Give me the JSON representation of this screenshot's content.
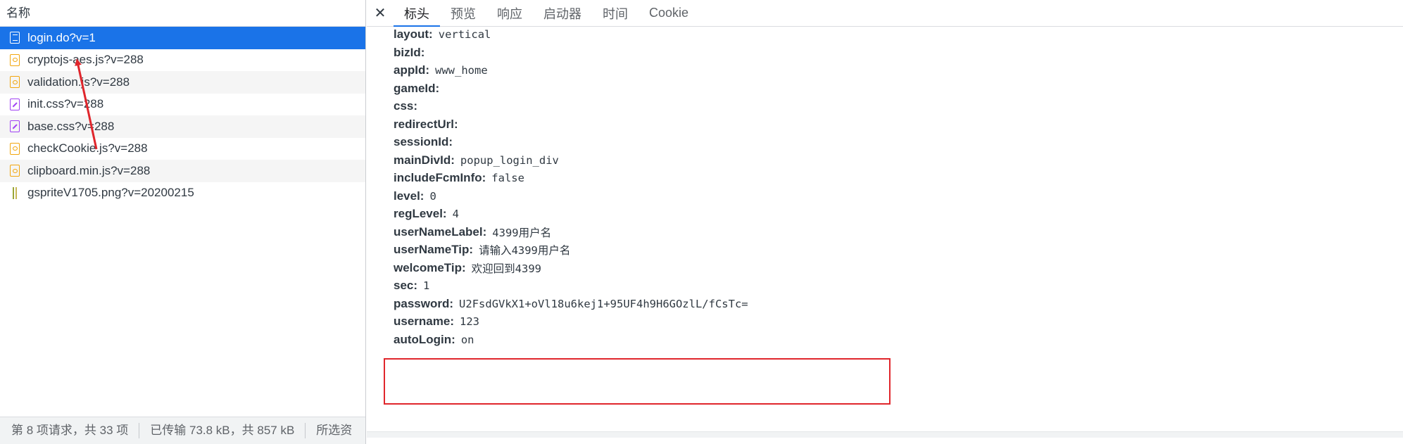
{
  "left_panel": {
    "header": "名称",
    "requests": [
      {
        "name": "login.do?v=1",
        "icon": "document-icon"
      },
      {
        "name": "cryptojs-aes.js?v=288",
        "icon": "script-icon"
      },
      {
        "name": "validation.js?v=288",
        "icon": "script-icon"
      },
      {
        "name": "init.css?v=288",
        "icon": "stylesheet-icon"
      },
      {
        "name": "base.css?v=288",
        "icon": "stylesheet-icon"
      },
      {
        "name": "checkCookie.js?v=288",
        "icon": "script-icon"
      },
      {
        "name": "clipboard.min.js?v=288",
        "icon": "script-icon"
      },
      {
        "name": "gspriteV1705.png?v=20200215",
        "icon": "image-icon"
      }
    ],
    "status": {
      "requests": "第 8 项请求，共 33 项",
      "transferred": "已传输 73.8 kB，共 857 kB",
      "selected": "所选资"
    }
  },
  "right_panel": {
    "close_label": "✕",
    "tabs": [
      {
        "label": "标头",
        "active": true
      },
      {
        "label": "预览",
        "active": false
      },
      {
        "label": "响应",
        "active": false
      },
      {
        "label": "启动器",
        "active": false
      },
      {
        "label": "时间",
        "active": false
      },
      {
        "label": "Cookie",
        "active": false
      }
    ],
    "form_fields": [
      {
        "key": "layout:",
        "value": "vertical"
      },
      {
        "key": "bizId:",
        "value": ""
      },
      {
        "key": "appId:",
        "value": "www_home"
      },
      {
        "key": "gameId:",
        "value": ""
      },
      {
        "key": "css:",
        "value": ""
      },
      {
        "key": "redirectUrl:",
        "value": ""
      },
      {
        "key": "sessionId:",
        "value": ""
      },
      {
        "key": "mainDivId:",
        "value": "popup_login_div"
      },
      {
        "key": "includeFcmInfo:",
        "value": "false"
      },
      {
        "key": "level:",
        "value": "0"
      },
      {
        "key": "regLevel:",
        "value": "4"
      },
      {
        "key": "userNameLabel:",
        "value": "4399用户名"
      },
      {
        "key": "userNameTip:",
        "value": "请输入4399用户名"
      },
      {
        "key": "welcomeTip:",
        "value": "欢迎回到4399"
      },
      {
        "key": "sec:",
        "value": "1"
      },
      {
        "key": "password:",
        "value": "U2FsdGVkX1+oVl18u6kej1+95UF4h9H6GOzlL/fCsTc="
      },
      {
        "key": "username:",
        "value": "123"
      },
      {
        "key": "autoLogin:",
        "value": "on"
      }
    ]
  },
  "colors": {
    "selected_row": "#1a73e8",
    "annotation_red": "#e0262c",
    "script_icon": "#f2a60d",
    "stylesheet_icon": "#a142f4"
  }
}
